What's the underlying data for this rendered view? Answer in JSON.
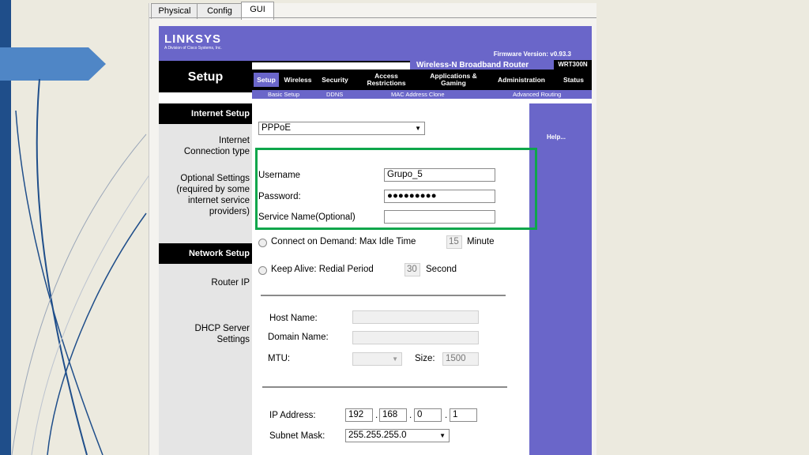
{
  "tabs": [
    "Physical",
    "Config",
    "GUI"
  ],
  "active_tab": "GUI",
  "brand": {
    "logo": "LINKSYS",
    "sub": "A Division of Cisco Systems, Inc."
  },
  "firmware": "Firmware Version: v0.93.3",
  "product": {
    "name": "Wireless-N Broadband Router",
    "model": "WRT300N"
  },
  "page_title": "Setup",
  "nav": [
    "Setup",
    "Wireless",
    "Security",
    "Access Restrictions",
    "Applications & Gaming",
    "Administration",
    "Status"
  ],
  "subnav": [
    "Basic Setup",
    "DDNS",
    "MAC Address Clone",
    "Advanced Routing"
  ],
  "left": {
    "internet_setup": "Internet Setup",
    "conn_type": "Internet Connection type",
    "optional": "Optional Settings (required by some internet service providers)",
    "network_setup": "Network Setup",
    "router_ip": "Router IP",
    "dhcp": "DHCP Server Settings"
  },
  "help": "Help...",
  "form": {
    "conn_type_value": "PPPoE",
    "username_label": "Username",
    "username_value": "Grupo_5",
    "password_label": "Password:",
    "password_value": "●●●●●●●●●",
    "service_label": "Service Name(Optional)",
    "service_value": "",
    "connect_demand": "Connect on Demand: Max Idle Time",
    "idle_value": "15",
    "idle_unit": "Minute",
    "keep_alive": "Keep Alive: Redial Period",
    "redial_value": "30",
    "redial_unit": "Second",
    "host_label": "Host Name:",
    "domain_label": "Domain Name:",
    "mtu_label": "MTU:",
    "size_label": "Size:",
    "size_value": "1500",
    "ip_label": "IP Address:",
    "ip": [
      "192",
      "168",
      "0",
      "1"
    ],
    "mask_label": "Subnet Mask:",
    "mask_value": "255.255.255.0"
  },
  "colors": {
    "header": "#6a66c9",
    "highlight": "#0ea64b",
    "slide_bar": "#1f4e8a"
  }
}
